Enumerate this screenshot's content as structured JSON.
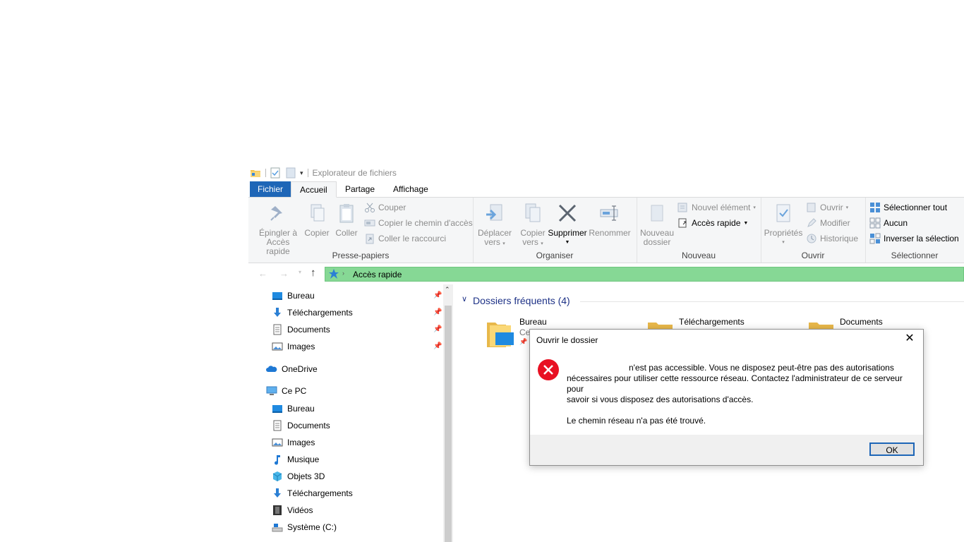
{
  "window": {
    "title": "Explorateur de fichiers",
    "tabs": [
      {
        "label": "Fichier"
      },
      {
        "label": "Accueil"
      },
      {
        "label": "Partage"
      },
      {
        "label": "Affichage"
      }
    ]
  },
  "ribbon": {
    "presse_papiers": {
      "label": "Presse-papiers",
      "pin_label_1": "Épingler à",
      "pin_label_2": "Accès rapide",
      "copy_label": "Copier",
      "paste_label": "Coller",
      "cut_label": "Couper",
      "copy_path_label": "Copier le chemin d'accès",
      "paste_shortcut_label": "Coller le raccourci"
    },
    "organiser": {
      "label": "Organiser",
      "move_label_1": "Déplacer",
      "move_label_2": "vers",
      "copyto_label_1": "Copier",
      "copyto_label_2": "vers",
      "delete_label": "Supprimer",
      "rename_label": "Renommer"
    },
    "nouveau": {
      "label": "Nouveau",
      "new_folder_label_1": "Nouveau",
      "new_folder_label_2": "dossier",
      "new_item_label": "Nouvel élément",
      "easy_access_label": "Accès rapide"
    },
    "ouvrir": {
      "label": "Ouvrir",
      "properties_label": "Propriétés",
      "open_label": "Ouvrir",
      "edit_label": "Modifier",
      "history_label": "Historique"
    },
    "selectionner": {
      "label": "Sélectionner",
      "select_all_label": "Sélectionner tout",
      "select_none_label": "Aucun",
      "invert_label": "Inverser la sélection"
    }
  },
  "address": {
    "path": "Accès rapide"
  },
  "sidebar": {
    "quick_access": [
      {
        "label": "Bureau"
      },
      {
        "label": "Téléchargements"
      },
      {
        "label": "Documents"
      },
      {
        "label": "Images"
      }
    ],
    "onedrive": "OneDrive",
    "this_pc": "Ce PC",
    "pc_items": [
      {
        "label": "Bureau"
      },
      {
        "label": "Documents"
      },
      {
        "label": "Images"
      },
      {
        "label": "Musique"
      },
      {
        "label": "Objets 3D"
      },
      {
        "label": "Téléchargements"
      },
      {
        "label": "Vidéos"
      },
      {
        "label": "Système (C:)"
      }
    ]
  },
  "content": {
    "section_title": "Dossiers fréquents (4)",
    "folders": [
      {
        "name": "Bureau",
        "sub": "Ce"
      },
      {
        "name": "Téléchargements"
      },
      {
        "name": "Documents"
      }
    ]
  },
  "dialog": {
    "title": "Ouvrir le dossier",
    "message_line1": "n'est pas accessible. Vous ne disposez peut-être pas des autorisations",
    "message_line2": "nécessaires pour utiliser cette ressource réseau. Contactez l'administrateur de ce serveur pour",
    "message_line3": "savoir si vous disposez des autorisations d'accès.",
    "detail": "Le chemin réseau n'a pas été trouvé.",
    "ok_label": "OK"
  },
  "colors": {
    "accent": "#1e66b7",
    "address_highlight": "#86d895",
    "error_red": "#e81123"
  }
}
